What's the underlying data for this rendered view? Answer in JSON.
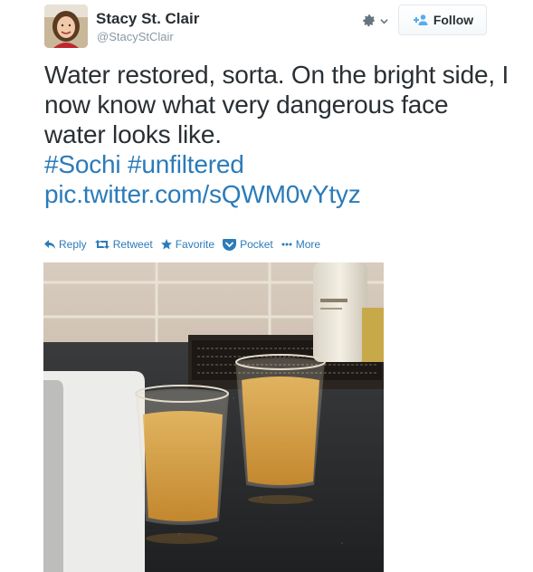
{
  "author": {
    "name": "Stacy St. Clair",
    "handle": "@StacyStClair"
  },
  "follow_label": "Follow",
  "tweet": {
    "text_plain": "Water restored, sorta. On the bright side, I now know what very dangerous face water looks like.",
    "hashtag_1": "#Sochi",
    "hashtag_2": "#unfiltered",
    "link": "pic.twitter.com/sQWM0vYtyz"
  },
  "actions": {
    "reply": "Reply",
    "retweet": "Retweet",
    "favorite": "Favorite",
    "pocket": "Pocket",
    "more": "More"
  },
  "colors": {
    "link": "#2b7bb9",
    "text": "#292f33",
    "muted": "#8899a6"
  }
}
